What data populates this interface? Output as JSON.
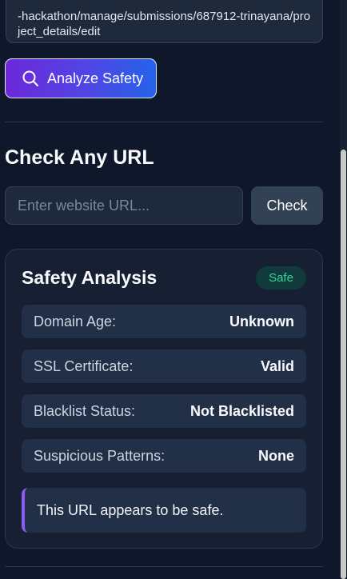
{
  "current_url": {
    "text": "-hackathon/manage/submissions/687912-trinayana/project_details/edit"
  },
  "analyze_button": {
    "label": "Analyze Safety",
    "icon": "search-icon"
  },
  "check_section": {
    "title": "Check Any URL",
    "input_value": "",
    "input_placeholder": "Enter website URL...",
    "check_label": "Check"
  },
  "analysis": {
    "title": "Safety Analysis",
    "badge": "Safe",
    "rows": [
      {
        "label": "Domain Age:",
        "value": "Unknown"
      },
      {
        "label": "SSL Certificate:",
        "value": "Valid"
      },
      {
        "label": "Blacklist Status:",
        "value": "Not Blacklisted"
      },
      {
        "label": "Suspicious Patterns:",
        "value": "None"
      }
    ],
    "message": "This URL appears to be safe."
  },
  "colors": {
    "background": "#0f172a",
    "card": "#172033",
    "row": "#223047",
    "accent_start": "#6d28d9",
    "accent_end": "#2563eb",
    "safe_green": "#34d399",
    "note_border": "#8b5cf6"
  }
}
